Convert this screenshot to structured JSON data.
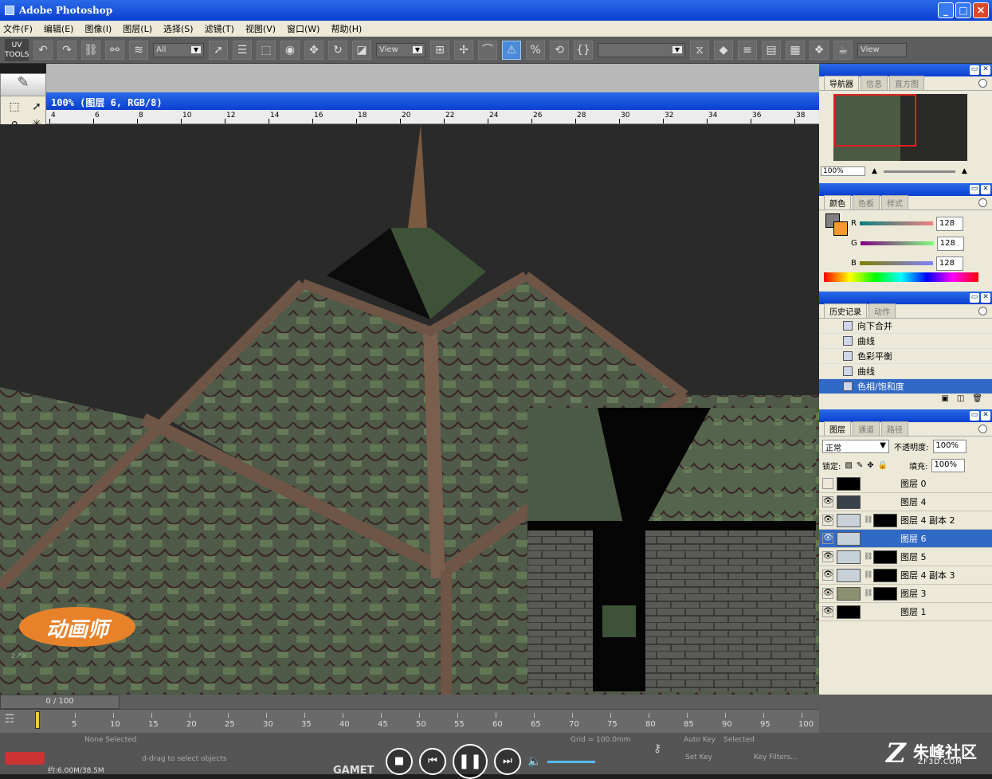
{
  "window": {
    "title": "Adobe Photoshop",
    "min": "_",
    "max": "□",
    "close": "✕"
  },
  "menu": [
    "文件(F)",
    "编辑(E)",
    "图像(I)",
    "图层(L)",
    "选择(S)",
    "滤镜(T)",
    "视图(V)",
    "窗口(W)",
    "帮助(H)"
  ],
  "toolbar": {
    "uv_tools": "UV TOOLS",
    "filter_value": "All",
    "view1": "View",
    "view2": "View"
  },
  "document": {
    "title": "100% (图层 6, RGB/8)"
  },
  "ruler": {
    "ticks": [
      "4",
      "6",
      "8",
      "10",
      "12",
      "14",
      "16",
      "18",
      "20",
      "22",
      "24",
      "26",
      "28",
      "30",
      "32",
      "34",
      "36",
      "38"
    ]
  },
  "brand": {
    "text": "动画师"
  },
  "navigator": {
    "tabs": [
      "导航器",
      "信息",
      "直方图"
    ],
    "zoom": "100%"
  },
  "color": {
    "tabs": [
      "颜色",
      "色板",
      "样式"
    ],
    "r_label": "R",
    "g_label": "G",
    "b_label": "B",
    "r": "128",
    "g": "128",
    "b": "128",
    "fg": "#808080",
    "bg": "#f59a28"
  },
  "history": {
    "tabs": [
      "历史记录",
      "动作"
    ],
    "items": [
      "向下合并",
      "曲线",
      "色彩平衡",
      "曲线",
      "色相/饱和度"
    ],
    "selected_index": 4
  },
  "layers": {
    "tabs": [
      "图层",
      "通道",
      "路径"
    ],
    "blend_mode": "正常",
    "opacity_label": "不透明度:",
    "opacity": "100%",
    "lock_label": "锁定:",
    "fill_label": "填充:",
    "fill": "100%",
    "items": [
      {
        "name": "图层 0",
        "visible": false
      },
      {
        "name": "图层 4",
        "visible": true
      },
      {
        "name": "图层 4 副本 2",
        "visible": true
      },
      {
        "name": "图层 6",
        "visible": true
      },
      {
        "name": "图层 5",
        "visible": true
      },
      {
        "name": "图层 4 副本 3",
        "visible": true
      },
      {
        "name": "图层 3",
        "visible": true
      },
      {
        "name": "图层 1",
        "visible": true
      }
    ],
    "selected_index": 3
  },
  "timeline": {
    "frame": "0 / 100",
    "ticks": [
      "5",
      "10",
      "15",
      "20",
      "25",
      "30",
      "35",
      "40",
      "45",
      "50",
      "55",
      "60",
      "65",
      "70",
      "75",
      "80",
      "85",
      "90",
      "95",
      "100"
    ]
  },
  "status": {
    "selection": "None Selected",
    "hint": "d-drag to select objects",
    "grid": "Grid = 100.0mm",
    "autokey": "Auto Key",
    "selected": "Selected",
    "setkey": "Set Key",
    "keyfilters": "Key Filters...",
    "mem": "约:6.00M/38.5M",
    "gamet": "GAMET"
  },
  "watermark": {
    "zh": "朱峰社区",
    "en": "ZF3D.COM"
  }
}
